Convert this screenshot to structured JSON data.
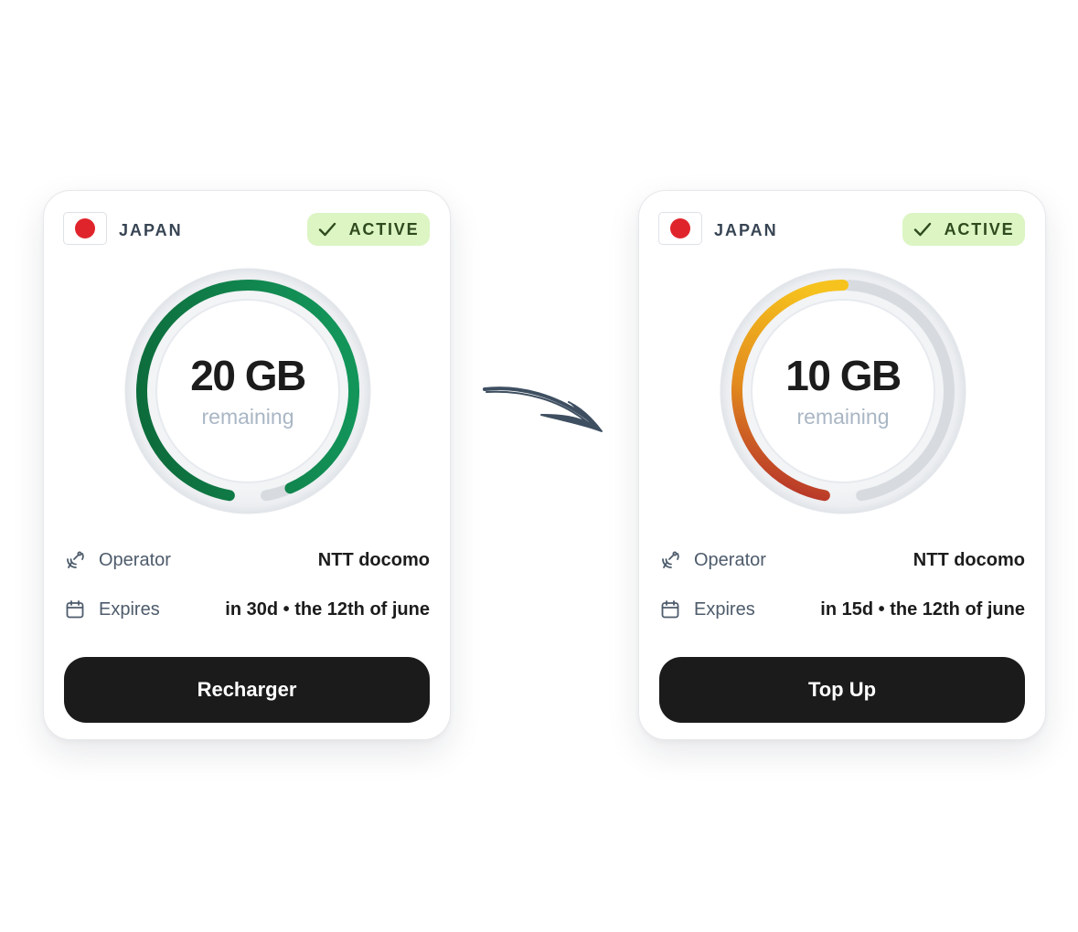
{
  "colors": {
    "flag_red": "#e0242b",
    "badge_bg": "#dcf5c3",
    "badge_text": "#2f4a1e",
    "button_bg": "#1b1b1b",
    "ring_track": "#d7dbe0",
    "green_start": "#0d6a3a",
    "green_end": "#13955a",
    "amber_start": "#b7342a",
    "amber_mid": "#e28a1e",
    "amber_end": "#f6c21d"
  },
  "cards": [
    {
      "country": "JAPAN",
      "flag_icon": "japan-flag-icon",
      "status": "ACTIVE",
      "status_icon": "check-icon",
      "remaining": "20 GB",
      "remaining_label": "remaining",
      "remaining_fraction": 0.96,
      "gauge_style": "green",
      "operator_icon": "satellite-signal-icon",
      "operator_label": "Operator",
      "operator_value": "NTT docomo",
      "expires_icon": "calendar-icon",
      "expires_label": "Expires",
      "expires_value": "in 30d • the 12th of june",
      "button_label": "Recharger"
    },
    {
      "country": "JAPAN",
      "flag_icon": "japan-flag-icon",
      "status": "ACTIVE",
      "status_icon": "check-icon",
      "remaining": "10 GB",
      "remaining_label": "remaining",
      "remaining_fraction": 0.5,
      "gauge_style": "amber",
      "operator_icon": "satellite-signal-icon",
      "operator_label": "Operator",
      "operator_value": "NTT docomo",
      "expires_icon": "calendar-icon",
      "expires_label": "Expires",
      "expires_value": "in 15d • the 12th of june",
      "button_label": "Top Up"
    }
  ],
  "transition_icon": "hand-drawn-arrow-icon"
}
